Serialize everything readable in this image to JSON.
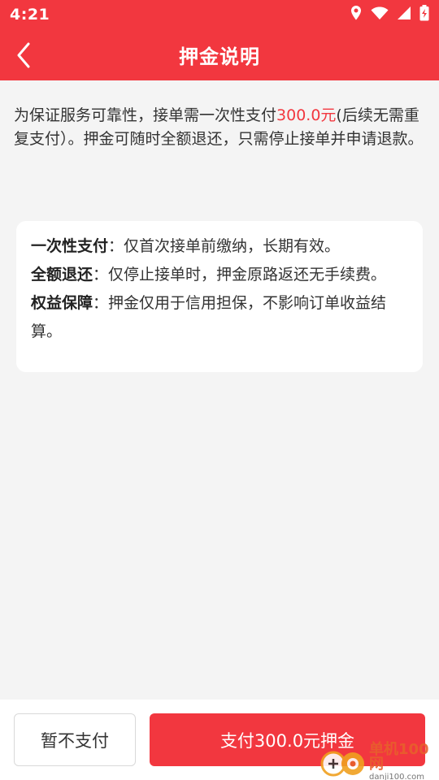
{
  "status": {
    "time": "4:21"
  },
  "nav": {
    "title": "押金说明"
  },
  "intro": {
    "before": "为保证服务可靠性，接单需一次性支付",
    "amount": "300.0元",
    "after": "(后续无需重复支付）。押金可随时全额退还，只需停止接单并申请退款。"
  },
  "card": {
    "items": [
      {
        "label": "一次性支付",
        "text": "：仅首次接单前缴纳，长期有效。"
      },
      {
        "label": "全额退还",
        "text": "：仅停止接单时，押金原路返还无手续费。"
      },
      {
        "label": "权益保障",
        "text": "：押金仅用于信用担保，不影响订单收益结算。"
      }
    ]
  },
  "buttons": {
    "skip": "暂不支付",
    "pay": "支付300.0元押金"
  },
  "watermark": {
    "name": "单机100网",
    "url": "danji100.com"
  },
  "colors": {
    "accent": "#f2373f"
  },
  "icons": [
    "location-icon",
    "wifi-icon",
    "signal-icon",
    "battery-charging-icon",
    "back-arrow-icon"
  ]
}
